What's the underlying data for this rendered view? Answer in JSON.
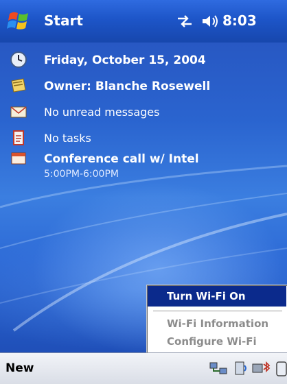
{
  "title_bar": {
    "title": "Start",
    "time": "8:03",
    "icons": [
      "windows-start-flag-icon",
      "connectivity-arrows-icon",
      "volume-icon"
    ]
  },
  "today": {
    "date": "Friday, October 15, 2004",
    "owner": "Owner: Blanche Rosewell",
    "messages": "No unread messages",
    "tasks": "No tasks",
    "appointment": {
      "title": "Conference call w/ Intel",
      "time": "5:00PM-6:00PM"
    }
  },
  "context_menu": {
    "items": [
      {
        "label": "Turn Wi-Fi On",
        "selected": true
      },
      {
        "label": "Wi-Fi Information",
        "selected": false
      },
      {
        "label": "Configure Wi-Fi",
        "selected": false
      }
    ]
  },
  "bottom_bar": {
    "left_softkey": "New",
    "tray_icons": [
      "network-sync-icon",
      "wifi-icon",
      "bluetooth-icon"
    ]
  },
  "colors": {
    "title_bar": "#1d55c8",
    "menu_highlight": "#0b2a8c",
    "bottom_bar": "#e4e7ee"
  }
}
